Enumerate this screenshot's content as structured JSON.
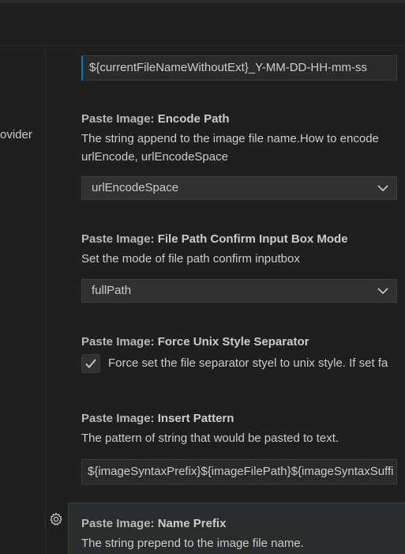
{
  "toc": {
    "partial_item": "ovider"
  },
  "filename_format_input": {
    "value": "${currentFileNameWithoutExt}_Y-MM-DD-HH-mm-ss"
  },
  "encode_path": {
    "category": "Paste Image: ",
    "name": "Encode Path",
    "description_line1": "The string append to the image file name.How to encode",
    "description_line2": "urlEncode, urlEncodeSpace",
    "selected": "urlEncodeSpace"
  },
  "confirm_mode": {
    "category": "Paste Image: ",
    "name": "File Path Confirm Input Box Mode",
    "description": "Set the mode of file path confirm inputbox",
    "selected": "fullPath"
  },
  "unix_separator": {
    "category": "Paste Image: ",
    "name": "Force Unix Style Separator",
    "checked": true,
    "label": "Force set the file separator styel to unix style. If set fa"
  },
  "insert_pattern": {
    "category": "Paste Image: ",
    "name": "Insert Pattern",
    "description": "The pattern of string that would be pasted to text.",
    "value": "${imageSyntaxPrefix}${imageFilePath}${imageSyntaxSuffi"
  },
  "name_prefix": {
    "category": "Paste Image: ",
    "name": "Name Prefix",
    "description": "The string prepend to the image file name."
  },
  "icons": {
    "gear": "gear-icon",
    "chevron": "chevron-down-icon",
    "check": "check-icon"
  },
  "colors": {
    "background": "#1f1f1f",
    "focus": "#007acc",
    "hover_row": "#2a2d2e"
  }
}
